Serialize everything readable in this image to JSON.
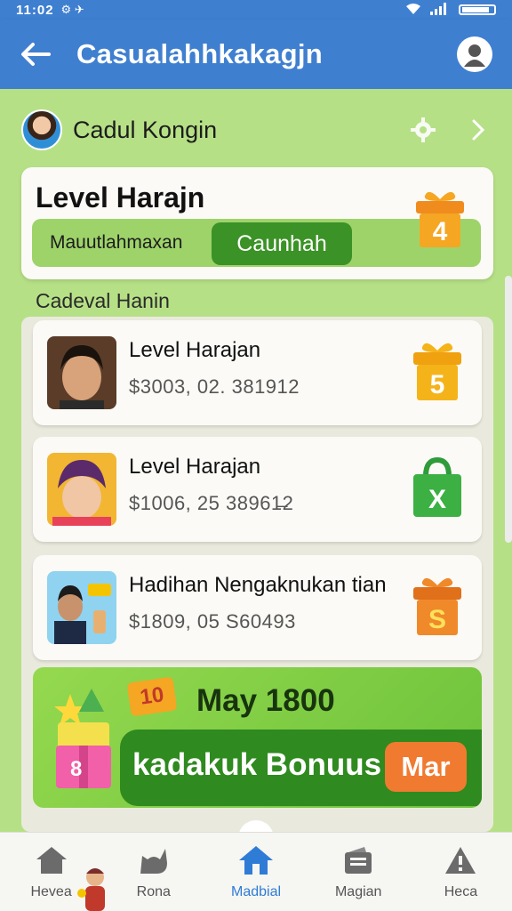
{
  "status_bar": {
    "time": "11:02",
    "left_icons": "⚙ ✈"
  },
  "app_bar": {
    "title": "Casualahhkakagjn"
  },
  "profile": {
    "name": "Cadu‌l Kongin"
  },
  "level_card": {
    "title": "Level Harajn",
    "bar_label": "Mauutlahmaxan",
    "button_label": "Caunhah",
    "gift_number": "4"
  },
  "section": {
    "title": "Cadeval Hanin"
  },
  "rewards": [
    {
      "title": "Level Harajan",
      "subtitle": "$3003, 02. 381912",
      "badge": "5",
      "badge_type": "gift",
      "badge_color": "#f5b31a"
    },
    {
      "title": "Level Harajan",
      "subtitle": "$1006, 25  38961̶2",
      "badge": "X",
      "badge_type": "bag",
      "badge_color": "#3cb043"
    },
    {
      "title": "Hadihan Nengaknukan tian",
      "subtitle": "$1809, 05  S60493",
      "badge": "S",
      "badge_type": "gift",
      "badge_color": "#f0892a"
    }
  ],
  "bonus": {
    "date": "May 1800",
    "text": "kadakuk Bonuus",
    "button_label": "Mar"
  },
  "bottom_nav": [
    {
      "label": "Hevea",
      "icon": "home-icon",
      "active": false
    },
    {
      "label": "Rona",
      "icon": "cat-icon",
      "active": false
    },
    {
      "label": "Madbial",
      "icon": "home-icon",
      "active": true
    },
    {
      "label": "Magian",
      "icon": "wallet-icon",
      "active": false
    },
    {
      "label": "Heca",
      "icon": "alert-icon",
      "active": false
    }
  ],
  "colors": {
    "primary": "#3f7fd0",
    "green": "#3b9226",
    "orange": "#f07a2f",
    "background": "#b6e086"
  }
}
